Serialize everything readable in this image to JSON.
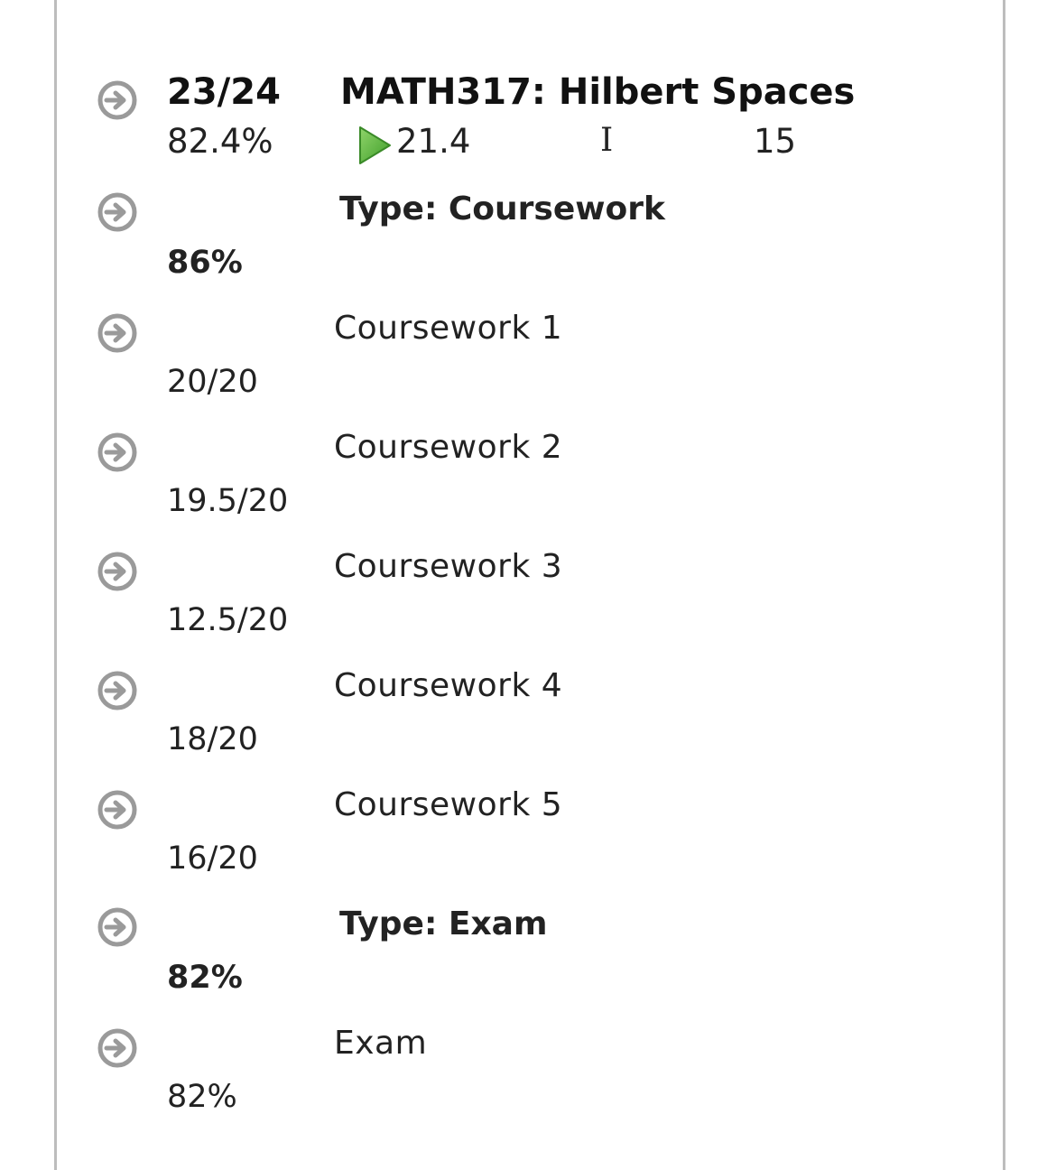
{
  "module": {
    "score": "23/24",
    "title": "MATH317: Hilbert Spaces",
    "percent": "82.4%",
    "mark_value": "21.4",
    "grade_symbol": "I",
    "credits": "15",
    "mark_icon": "green-play-triangle"
  },
  "groups": [
    {
      "heading": "Type: Coursework",
      "percent": "86%",
      "items": [
        {
          "name": "Coursework 1",
          "score": "20/20"
        },
        {
          "name": "Coursework 2",
          "score": "19.5/20"
        },
        {
          "name": "Coursework 3",
          "score": "12.5/20"
        },
        {
          "name": "Coursework 4",
          "score": "18/20"
        },
        {
          "name": "Coursework 5",
          "score": "16/20"
        }
      ]
    },
    {
      "heading": "Type: Exam",
      "percent": "82%",
      "items": [
        {
          "name": "Exam",
          "score": "82%"
        }
      ]
    }
  ],
  "icons": {
    "row_arrow": "arrow-right-circle-icon",
    "arrow_color": "#999999"
  }
}
